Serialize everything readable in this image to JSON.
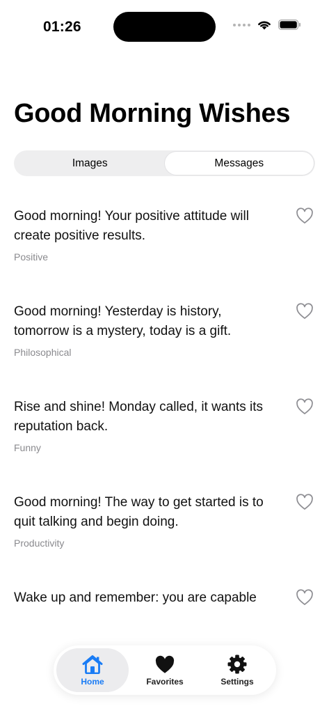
{
  "status_bar": {
    "time": "01:26"
  },
  "page": {
    "title": "Good Morning Wishes"
  },
  "segments": [
    {
      "label": "Images",
      "active": false
    },
    {
      "label": "Messages",
      "active": true
    }
  ],
  "messages": [
    {
      "text": "Good morning! Your positive attitude will create positive results.",
      "category": "Positive"
    },
    {
      "text": "Good morning! Yesterday is history, tomorrow is a mystery, today is a gift.",
      "category": "Philosophical"
    },
    {
      "text": "Rise and shine! Monday called, it wants its reputation back.",
      "category": "Funny"
    },
    {
      "text": "Good morning! The way to get started is to quit talking and begin doing.",
      "category": "Productivity"
    },
    {
      "text": "Wake up and remember: you are capable",
      "category": ""
    }
  ],
  "tab_bar": {
    "items": [
      {
        "label": "Home",
        "icon": "house-icon",
        "active": true
      },
      {
        "label": "Favorites",
        "icon": "heart-icon",
        "active": false
      },
      {
        "label": "Settings",
        "icon": "gear-icon",
        "active": false
      }
    ]
  },
  "colors": {
    "accent": "#1a7cf5",
    "secondary_text": "#8a8a8e",
    "segment_bg": "#eeeeef"
  }
}
